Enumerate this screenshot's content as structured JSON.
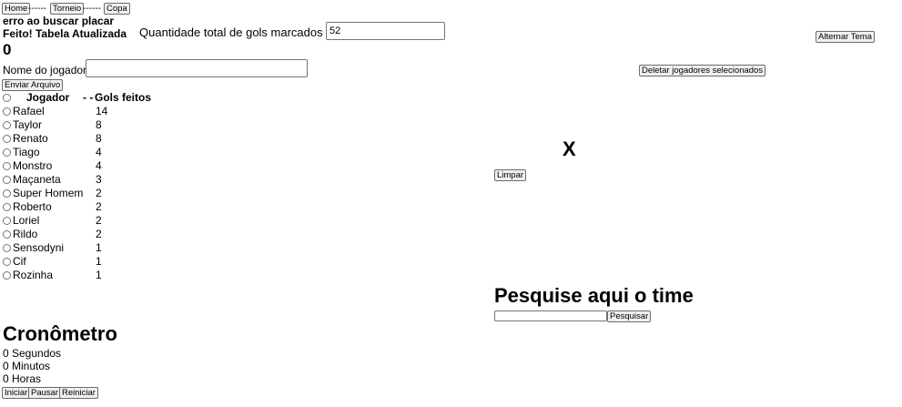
{
  "nav": {
    "home": "Home",
    "sep1": "------",
    "torneio": "Torneio",
    "sep2": "------",
    "copa": "Copa"
  },
  "status": {
    "error": "erro ao buscar placar",
    "success": "Feito! Tabela Atualizada"
  },
  "total_goals": {
    "label": "Quantidade total de gols marcados",
    "value": "52"
  },
  "counter": "0",
  "theme_button": "Alternar Tema",
  "player_form": {
    "label": "Nome do jogador",
    "value": "",
    "submit": "Enviar Arquivo"
  },
  "delete_button": "Deletar jogadores selecionados",
  "table": {
    "headers": {
      "player": "Jogador",
      "separator": "- -",
      "goals": "Gols feitos"
    },
    "rows": [
      {
        "name": "Rafael",
        "goals": "14"
      },
      {
        "name": "Taylor",
        "goals": "8"
      },
      {
        "name": "Renato",
        "goals": "8"
      },
      {
        "name": "Tiago",
        "goals": "4"
      },
      {
        "name": "Monstro",
        "goals": "4"
      },
      {
        "name": "Maçaneta",
        "goals": "3"
      },
      {
        "name": "Super Homem",
        "goals": "2"
      },
      {
        "name": "Roberto",
        "goals": "2"
      },
      {
        "name": "Loriel",
        "goals": "2"
      },
      {
        "name": "Rildo",
        "goals": "2"
      },
      {
        "name": "Sensodyni",
        "goals": "1"
      },
      {
        "name": "Cif",
        "goals": "1"
      },
      {
        "name": "Rozinha",
        "goals": "1"
      }
    ]
  },
  "match": {
    "versus": "X",
    "clear_button": "Limpar"
  },
  "search": {
    "title": "Pesquise aqui o time",
    "value": "",
    "button": "Pesquisar"
  },
  "stopwatch": {
    "title": "Cronômetro",
    "seconds": "0 Segundos",
    "minutes": "0 Minutos",
    "hours": "0 Horas",
    "start": "Iniciar",
    "pause": "Pausar",
    "restart": "Reiniciar"
  }
}
